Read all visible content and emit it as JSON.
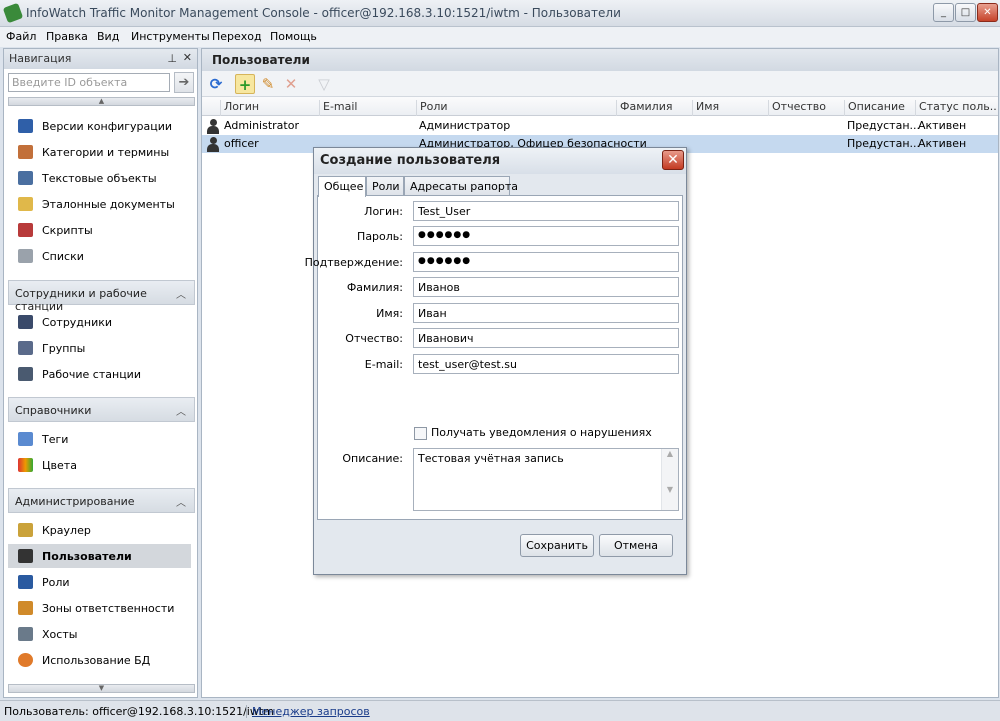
{
  "window": {
    "title": "InfoWatch Traffic Monitor Management Console - officer@192.168.3.10:1521/iwtm - Пользователи",
    "minimize": "_",
    "maximize": "□",
    "close": "✕"
  },
  "menu": [
    "Файл",
    "Правка",
    "Вид",
    "Инструменты",
    "Переход",
    "Помощь"
  ],
  "navigation": {
    "title": "Навигация",
    "search_placeholder": "Введите ID объекта",
    "go_icon": "arrow-right-icon",
    "items_top": [
      {
        "label": "Версии конфигурации",
        "icon": "gear-icon"
      },
      {
        "label": "Категории и термины",
        "icon": "book-icon"
      },
      {
        "label": "Текстовые объекты",
        "icon": "text-object-icon"
      },
      {
        "label": "Эталонные документы",
        "icon": "document-icon"
      },
      {
        "label": "Скрипты",
        "icon": "script-icon"
      },
      {
        "label": "Списки",
        "icon": "list-icon"
      }
    ],
    "groups": [
      {
        "title": "Сотрудники и рабочие станции",
        "items": [
          {
            "label": "Сотрудники",
            "icon": "employee-icon"
          },
          {
            "label": "Группы",
            "icon": "group-icon"
          },
          {
            "label": "Рабочие станции",
            "icon": "workstation-icon"
          }
        ]
      },
      {
        "title": "Справочники",
        "items": [
          {
            "label": "Теги",
            "icon": "tag-icon"
          },
          {
            "label": "Цвета",
            "icon": "colors-icon"
          }
        ]
      },
      {
        "title": "Администрирование",
        "items": [
          {
            "label": "Краулер",
            "icon": "crawler-icon"
          },
          {
            "label": "Пользователи",
            "icon": "user-icon",
            "selected": true
          },
          {
            "label": "Роли",
            "icon": "role-icon"
          },
          {
            "label": "Зоны ответственности",
            "icon": "zones-icon"
          },
          {
            "label": "Хосты",
            "icon": "host-icon"
          },
          {
            "label": "Использование БД",
            "icon": "db-usage-icon"
          }
        ]
      }
    ]
  },
  "users_panel": {
    "title": "Пользователи",
    "columns": [
      "Логин",
      "E-mail",
      "Роли",
      "Фамилия",
      "Имя",
      "Отчество",
      "Описание",
      "Статус поль..."
    ],
    "rows": [
      {
        "login": "Administrator",
        "email": "",
        "roles": "Администратор",
        "lastname": "",
        "firstname": "",
        "middlename": "",
        "description": "Предустан...",
        "status": "Активен"
      },
      {
        "login": "officer",
        "email": "",
        "roles": "Администратор, Офицер безопасности",
        "lastname": "",
        "firstname": "",
        "middlename": "",
        "description": "Предустан...",
        "status": "Активен"
      }
    ]
  },
  "dialog": {
    "title": "Создание пользователя",
    "tabs": [
      "Общее",
      "Роли",
      "Адресаты рапорта"
    ],
    "fields": {
      "login_label": "Логин:",
      "login": "Test_User",
      "password_label": "Пароль:",
      "password": "●●●●●●",
      "confirm_label": "Подтверждение:",
      "confirm": "●●●●●●",
      "lastname_label": "Фамилия:",
      "lastname": "Иванов",
      "firstname_label": "Имя:",
      "firstname": "Иван",
      "middlename_label": "Отчество:",
      "middlename": "Иванович",
      "email_label": "E-mail:",
      "email": "test_user@test.su",
      "notify_label": "Получать уведомления о нарушениях",
      "description_label": "Описание:",
      "description": "Тестовая учётная запись"
    },
    "save": "Сохранить",
    "cancel": "Отмена"
  },
  "status": {
    "user": "Пользователь: officer@192.168.3.10:1521/iwtm",
    "queries_link": "Менеджер запросов"
  }
}
